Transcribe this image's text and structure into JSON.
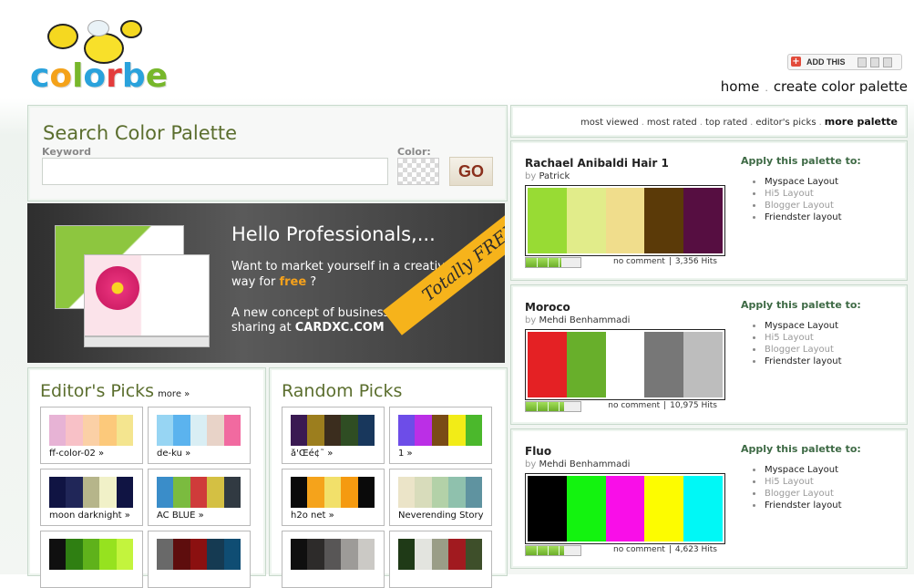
{
  "header": {
    "logo_text": "colorbe",
    "addthis_label": "ADD THIS",
    "nav": {
      "home": "home",
      "separator": ".",
      "create": "create color palette"
    }
  },
  "search": {
    "title": "Search Color Palette",
    "keyword_label": "Keyword",
    "keyword_value": "",
    "color_label": "Color:",
    "go_label": "GO"
  },
  "banner": {
    "title": "Hello Professionals,...",
    "line1": "Want to market yourself in a creative",
    "line2_prefix": "way for ",
    "line2_free": "free",
    "line2_suffix": " ?",
    "line3": "A new concept of business card",
    "line4_prefix": "sharing at ",
    "line4_site": "CARDXC.COM",
    "ribbon": "Totally FREE !"
  },
  "editors_picks": {
    "title": "Editor's Picks",
    "more": "more »",
    "items": [
      {
        "name": "ff-color-02 »",
        "colors": [
          "#e7b3d5",
          "#f8c1c7",
          "#fbd0a6",
          "#fcc97b",
          "#f4e58f"
        ]
      },
      {
        "name": "de-ku »",
        "colors": [
          "#97d5f3",
          "#5bb3ee",
          "#d9eef4",
          "#e8d3c8",
          "#f16aa0"
        ]
      },
      {
        "name": "moon darknight »",
        "colors": [
          "#101443",
          "#202658",
          "#b6b58a",
          "#f1f1c8",
          "#101443"
        ]
      },
      {
        "name": "AC BLUE »",
        "colors": [
          "#3a8dc9",
          "#7bbb3f",
          "#cf3b3a",
          "#d4c043",
          "#313a42"
        ]
      },
      {
        "name": "",
        "colors": [
          "#101010",
          "#2f7f12",
          "#5fb21b",
          "#96e21f",
          "#c3f43d"
        ]
      },
      {
        "name": "",
        "colors": [
          "#696969",
          "#5e0d0d",
          "#8b1010",
          "#153a52",
          "#0f4d73"
        ]
      }
    ]
  },
  "random_picks": {
    "title": "Random Picks",
    "items": [
      {
        "name": "å'Œé¢˜ »",
        "colors": [
          "#3a1a52",
          "#9c7e1e",
          "#3b2d1e",
          "#2f4d23",
          "#18375c"
        ]
      },
      {
        "name": "1 »",
        "colors": [
          "#6d4de8",
          "#bb2fe6",
          "#7a4b16",
          "#f2ec17",
          "#4bb82c"
        ]
      },
      {
        "name": "h2o net »",
        "colors": [
          "#0a0a0a",
          "#f5a31b",
          "#f2e06a",
          "#f59a10",
          "#0a0a0a"
        ]
      },
      {
        "name": "Neverending Story",
        "colors": [
          "#ebe4c8",
          "#d8dcbb",
          "#b3d1a8",
          "#8fc1ad",
          "#5f93a0"
        ]
      },
      {
        "name": "",
        "colors": [
          "#0f0f0f",
          "#2d2b2a",
          "#585656",
          "#9d9b98",
          "#cbc9c5"
        ]
      },
      {
        "name": "",
        "colors": [
          "#1f3a17",
          "#e3e4df",
          "#9a9d87",
          "#a11a1f",
          "#3e4f2a"
        ]
      }
    ]
  },
  "sortbar": {
    "most_viewed": "most viewed",
    "most_rated": "most rated",
    "top_rated": "top rated",
    "editors_picks": "editor's picks",
    "more_palette": "more palette",
    "dot": "."
  },
  "palettes": [
    {
      "name": "Rachael Anibaldi Hair 1",
      "by_prefix": "by ",
      "author": "Patrick",
      "colors": [
        "#98db34",
        "#e1ec8a",
        "#f0dd8c",
        "#5b3a08",
        "#560e41"
      ],
      "rating": 0.65,
      "comment": "no comment",
      "sep": "|",
      "hits": "3,356 Hits",
      "apply_title": "Apply this palette to:",
      "apply": [
        "Myspace Layout",
        "Hi5 Layout",
        "Blogger Layout",
        "Friendster layout"
      ]
    },
    {
      "name": "Moroco",
      "by_prefix": "by ",
      "author": "Mehdi Benhammadi",
      "colors": [
        "#e42124",
        "#68af2b",
        "#ffffff",
        "#777777",
        "#bdbdbd"
      ],
      "rating": 0.7,
      "comment": "no comment",
      "sep": "|",
      "hits": "10,975 Hits",
      "apply_title": "Apply this palette to:",
      "apply": [
        "Myspace Layout",
        "Hi5 Layout",
        "Blogger Layout",
        "Friendster layout"
      ]
    },
    {
      "name": "Fluo",
      "by_prefix": "by ",
      "author": "Mehdi Benhammadi",
      "colors": [
        "#000000",
        "#13f30f",
        "#f90ee8",
        "#fdfc00",
        "#00f8f6"
      ],
      "rating": 0.7,
      "comment": "no comment",
      "sep": "|",
      "hits": "4,623 Hits",
      "apply_title": "Apply this palette to:",
      "apply": [
        "Myspace Layout",
        "Hi5 Layout",
        "Blogger Layout",
        "Friendster layout"
      ]
    }
  ]
}
